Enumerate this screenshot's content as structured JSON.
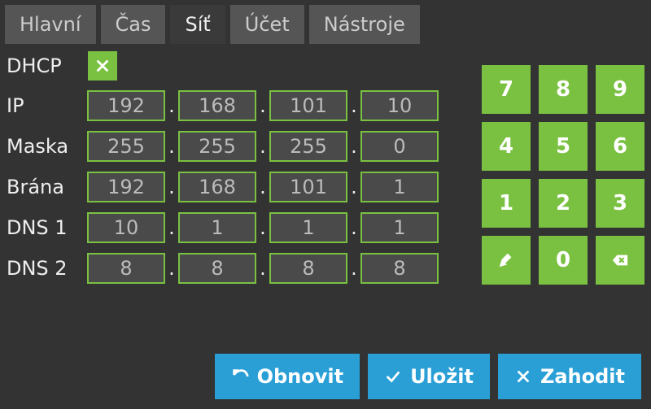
{
  "tabs": {
    "main": "Hlavní",
    "time": "Čas",
    "network": "Síť",
    "account": "Účet",
    "tools": "Nástroje"
  },
  "labels": {
    "dhcp": "DHCP",
    "ip": "IP",
    "mask": "Maska",
    "gateway": "Brána",
    "dns1": "DNS 1",
    "dns2": "DNS 2"
  },
  "dhcp_checked": true,
  "ip": {
    "o1": "192",
    "o2": "168",
    "o3": "101",
    "o4": "10"
  },
  "mask": {
    "o1": "255",
    "o2": "255",
    "o3": "255",
    "o4": "0"
  },
  "gateway": {
    "o1": "192",
    "o2": "168",
    "o3": "101",
    "o4": "1"
  },
  "dns1": {
    "o1": "10",
    "o2": "1",
    "o3": "1",
    "o4": "1"
  },
  "dns2": {
    "o1": "8",
    "o2": "8",
    "o3": "8",
    "o4": "8"
  },
  "keypad": {
    "k7": "7",
    "k8": "8",
    "k9": "9",
    "k4": "4",
    "k5": "5",
    "k6": "6",
    "k1": "1",
    "k2": "2",
    "k3": "3",
    "k0": "0"
  },
  "actions": {
    "refresh": "Obnovit",
    "save": "Uložit",
    "discard": "Zahodit"
  },
  "colors": {
    "accent_green": "#7ac142",
    "accent_blue": "#2a9fd6",
    "bg": "#333333"
  }
}
